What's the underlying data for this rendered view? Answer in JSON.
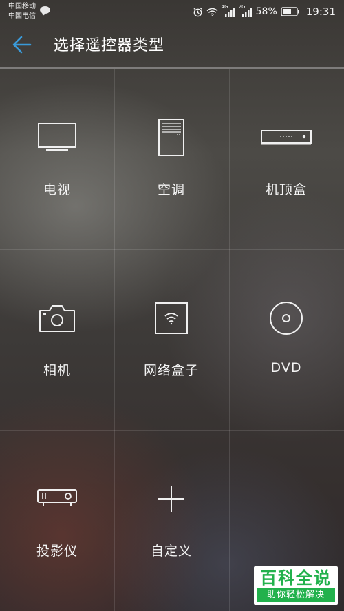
{
  "status_bar": {
    "carrier_1": "中国移动",
    "carrier_2": "中国电信",
    "network_1": "4G",
    "network_2": "2G",
    "battery": "58%",
    "time": "19:31"
  },
  "header": {
    "title": "选择遥控器类型"
  },
  "grid": {
    "items": [
      {
        "label": "电视",
        "icon": "tv-icon"
      },
      {
        "label": "空调",
        "icon": "air-conditioner-icon"
      },
      {
        "label": "机顶盒",
        "icon": "set-top-box-icon"
      },
      {
        "label": "相机",
        "icon": "camera-icon"
      },
      {
        "label": "网络盒子",
        "icon": "network-box-icon"
      },
      {
        "label": "DVD",
        "icon": "dvd-icon"
      },
      {
        "label": "投影仪",
        "icon": "projector-icon"
      },
      {
        "label": "自定义",
        "icon": "plus-icon"
      }
    ]
  },
  "watermark": {
    "title": "百科全说",
    "subtitle": "助你轻松解决"
  },
  "colors": {
    "accent": "#3a9ad9",
    "watermark_green": "#22b14c"
  }
}
